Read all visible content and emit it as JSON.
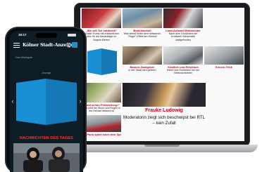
{
  "laptop": {
    "tiles": [
      {
        "kicker": "„Wir will Tee entdeckt!“",
        "head": "Donald Trump mit erstaunlicher Idee für die Neuauflage im Angela-Merkel"
      },
      {
        "kicker": "Brett-Neuheit",
        "head": "Was steckt hinter dem seltsamen \"Hügel\"-Effekt am Himmel"
      },
      {
        "kicker": "Land-Antwort Weltmeister",
        "head": "Nach dem Großbrand am Kraftwerk Wirtschafts stattgefunden"
      },
      {
        "kicker": "Bauern-Gastgeber",
        "head": "In der Stadt wird gefeiert"
      },
      {
        "kicker": "Köstlich und Reichtum",
        "head": "Eltern und Großeltern bei der Weihnachtsfeier"
      },
      {
        "kicker": "Kerzen-Trick",
        "head": "Neue Technik erobert den Alltag"
      },
      {
        "kicker": "„Bald schon Feststellung!“",
        "head": "Was jetzt bei Sturm und Regen in der Heimat bekannt ist"
      },
      {
        "kicker": "Ein Paris spielt nach dem Spielen",
        "head": "Vorbereitungsaktion für Ostern"
      }
    ],
    "featured": {
      "kicker": "Frauke Ludowig",
      "headline": "Moderatorin zeigt sich beschwipst bei RTL – kein Zufall"
    }
  },
  "phone": {
    "status_time": "16:17",
    "logo": "Kölner Stadt-Anzeiger",
    "sub_label": "Das Wichtigste",
    "ad_label": "Anzeige",
    "arrow_left": "‹",
    "arrow_right": "›",
    "section_title": "NACHRICHTEN DES TAGES"
  },
  "colors": {
    "brand_blue": "#1f8fd0",
    "accent_red": "#d0021b",
    "phone_bg": "#0e1c25"
  }
}
